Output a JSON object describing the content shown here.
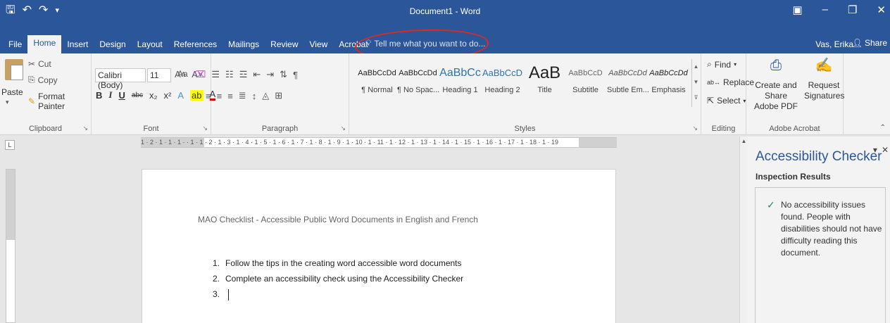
{
  "window": {
    "title": "Document1 - Word",
    "qat": [
      "save-icon",
      "undo-icon",
      "redo-icon",
      "customize-qat-icon"
    ],
    "controls": [
      "ribbon-display-icon",
      "minimize-icon",
      "restore-icon",
      "close-icon"
    ]
  },
  "menu": {
    "tabs": [
      "File",
      "Home",
      "Insert",
      "Design",
      "Layout",
      "References",
      "Mailings",
      "Review",
      "View",
      "Acrobat"
    ],
    "active_tab": "Home",
    "tell_me": "Tell me what you want to do...",
    "user": "Vas, Erika",
    "share": "Share"
  },
  "ribbon": {
    "clipboard": {
      "paste": "Paste",
      "cut": "Cut",
      "copy": "Copy",
      "format_painter": "Format Painter",
      "label": "Clipboard"
    },
    "font": {
      "name": "Calibri (Body)",
      "size": "11",
      "label": "Font",
      "change_case": "Aa"
    },
    "paragraph": {
      "label": "Paragraph"
    },
    "styles": {
      "label": "Styles",
      "items": [
        {
          "preview": "AaBbCcDd",
          "name": "¶ Normal"
        },
        {
          "preview": "AaBbCcDd",
          "name": "¶ No Spac..."
        },
        {
          "preview": "AaBbCc",
          "name": "Heading 1"
        },
        {
          "preview": "AaBbCcD",
          "name": "Heading 2"
        },
        {
          "preview": "AaB",
          "name": "Title"
        },
        {
          "preview": "AaBbCcD",
          "name": "Subtitle"
        },
        {
          "preview": "AaBbCcDd",
          "name": "Subtle Em..."
        },
        {
          "preview": "AaBbCcDd",
          "name": "Emphasis"
        }
      ]
    },
    "editing": {
      "find": "Find",
      "replace": "Replace",
      "select": "Select",
      "label": "Editing"
    },
    "acrobat": {
      "create_share": "Create and Share",
      "adobe_pdf": "Adobe PDF",
      "request": "Request",
      "signatures": "Signatures",
      "label": "Adobe Acrobat"
    }
  },
  "ruler": {
    "corner": "L",
    "marks": "1 · 2 · 1 · 1 · 1 ·  · 1 · 1 · 2 · 1 · 3 · 1 · 4 · 1 · 5 · 1 · 6 · 1 · 7 · 1 · 8 · 1 · 9 · 1 · 10 · 1 · 11 · 1 · 12 · 1 · 13 · 1 · 14 · 1 · 15 · 1 · 16 · 1 · 17 · 1 · 18 · 1 · 19"
  },
  "document": {
    "title": "MAO Checklist - Accessible Public Word Documents in English and French",
    "list": [
      {
        "num": "1.",
        "text": "Follow the tips in the creating word accessible word documents"
      },
      {
        "num": "2.",
        "text": "Complete an accessibility check using the Accessibility Checker"
      },
      {
        "num": "3.",
        "text": ""
      }
    ]
  },
  "accessibility_pane": {
    "title": "Accessibility Checker",
    "subtitle": "Inspection Results",
    "message": "No accessibility issues found. People with disabilities should not have difficulty reading this document."
  },
  "colors": {
    "word_blue": "#2b579a",
    "annotation_red": "#e0281f",
    "check_green": "#2e8b57"
  }
}
